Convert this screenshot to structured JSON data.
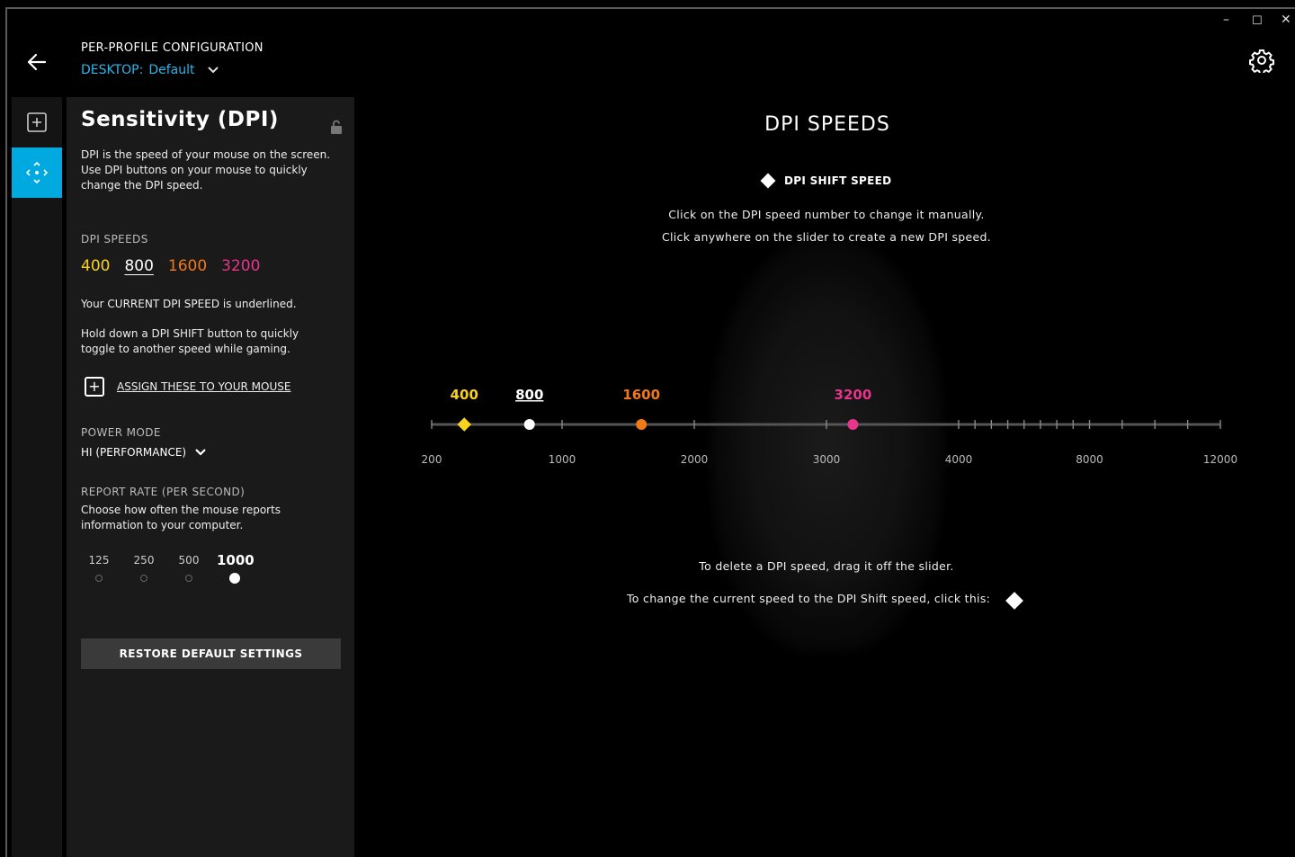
{
  "window": {
    "minimize": "–",
    "maximize": "☐",
    "close": "✕"
  },
  "header": {
    "title": "PER-PROFILE CONFIGURATION",
    "profile_key": "DESKTOP:",
    "profile_value": "Default"
  },
  "icons": {
    "back": "arrow-left-icon",
    "settings": "gear-icon",
    "add": "plus-square-icon",
    "sensitivity": "dpi-arrows-icon",
    "lock": "unlocked-padlock-icon",
    "dpi_shift": "diamond-icon"
  },
  "colors": {
    "accent": "#00a9e0",
    "profile_text": "#2fb6e8",
    "dpi_400": "#f7d21f",
    "dpi_800": "#ffffff",
    "dpi_1600": "#f07a1a",
    "dpi_3200": "#e6358b"
  },
  "panel": {
    "title": "Sensitivity (DPI)",
    "description": "DPI is the speed of your mouse on the screen. Use DPI buttons on your mouse to quickly change the DPI speed.",
    "dpi_speeds_label": "DPI SPEEDS",
    "dpi_speeds": [
      "400",
      "800",
      "1600",
      "3200"
    ],
    "current_note": "Your CURRENT DPI SPEED is underlined.",
    "shift_note": "Hold down a DPI SHIFT button to quickly toggle to another speed while gaming.",
    "assign_label": "ASSIGN THESE TO YOUR MOUSE",
    "power_mode_label": "POWER MODE",
    "power_mode_value": "HI (PERFORMANCE)",
    "report_rate_label": "REPORT RATE (PER SECOND)",
    "report_rate_desc": "Choose how often the mouse reports information to your computer.",
    "report_rates": [
      "125",
      "250",
      "500",
      "1000"
    ],
    "report_rate_selected": "1000",
    "restore_label": "RESTORE DEFAULT SETTINGS"
  },
  "main": {
    "title": "DPI SPEEDS",
    "shift_legend": "DPI SHIFT SPEED",
    "instruction_1": "Click on the DPI speed number to change it manually.",
    "instruction_2": "Click anywhere on the slider to create a new DPI speed.",
    "delete_note": "To delete a DPI speed, drag it off the slider.",
    "shift_click_note": "To change the current speed to the DPI Shift speed, click this:"
  },
  "slider": {
    "axis_labels": [
      "200",
      "1000",
      "2000",
      "3000",
      "4000",
      "8000",
      "12000"
    ],
    "current": "800",
    "shift": "400",
    "points": [
      {
        "label": "400",
        "value": 400,
        "marker": "diamond",
        "color": "#f7d21f"
      },
      {
        "label": "800",
        "value": 800,
        "marker": "circle",
        "color": "#ffffff"
      },
      {
        "label": "1600",
        "value": 1600,
        "marker": "circle",
        "color": "#f07a1a"
      },
      {
        "label": "3200",
        "value": 3200,
        "marker": "circle",
        "color": "#e6358b"
      }
    ]
  }
}
